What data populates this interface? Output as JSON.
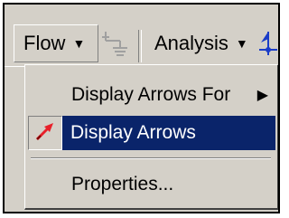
{
  "toolbar": {
    "flow_label": "Flow",
    "flow_dropdown_glyph": "▼",
    "analysis_label": "Analysis",
    "analysis_dropdown_glyph": "▼"
  },
  "menu": {
    "items": [
      {
        "label": "Display Arrows For",
        "has_submenu": true,
        "submenu_glyph": "▶"
      },
      {
        "label": "Display Arrows",
        "checked": true,
        "highlighted": true
      },
      {
        "label": "Properties..."
      }
    ]
  },
  "colors": {
    "highlight": "#0a246a",
    "face": "#d4d0c8",
    "arrow_icon": "#e8202a"
  },
  "icons": {
    "disabled_tool": "flow-tool-icon",
    "nav_tool": "navigation-icon",
    "display_arrows": "red-arrow-icon"
  }
}
